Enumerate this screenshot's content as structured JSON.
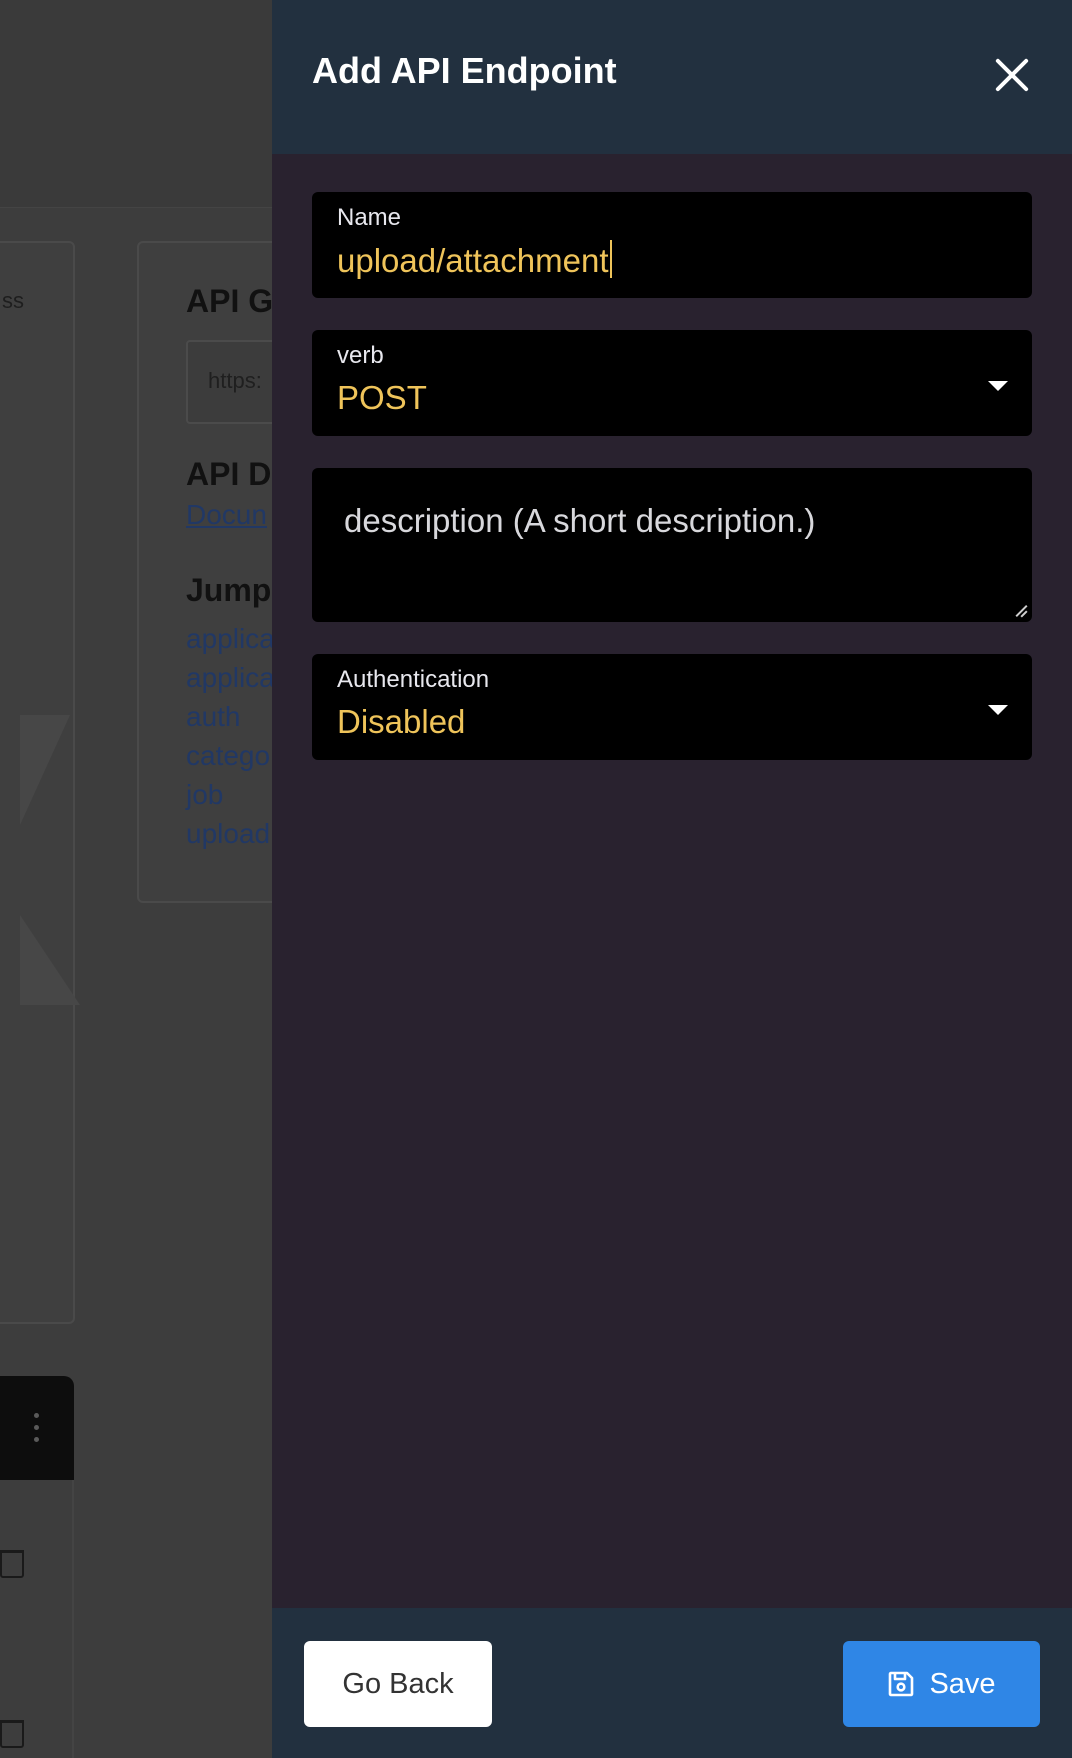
{
  "background": {
    "partial_text": "ss",
    "heading_api_g": "API G",
    "url_partial": "https:",
    "heading_api_d": "API D",
    "doc_link": "Docun",
    "heading_jump": "Jump",
    "jump_links": [
      "applica",
      "applica",
      "auth",
      "catego",
      "job",
      "upload"
    ]
  },
  "drawer": {
    "title": "Add API Endpoint",
    "close_icon": "close-icon",
    "fields": {
      "name": {
        "label": "Name",
        "value": "upload/attachment"
      },
      "verb": {
        "label": "verb",
        "value": "POST"
      },
      "description": {
        "placeholder": "description (A short description.)"
      },
      "authentication": {
        "label": "Authentication",
        "value": "Disabled"
      }
    },
    "footer": {
      "back_label": "Go Back",
      "save_label": "Save",
      "save_icon": "floppy-disk-icon"
    }
  },
  "colors": {
    "header_bg": "#22303f",
    "drawer_bg": "#29222f",
    "field_bg": "#000000",
    "value_text": "#efc45a",
    "save_button": "#2f86e6"
  }
}
